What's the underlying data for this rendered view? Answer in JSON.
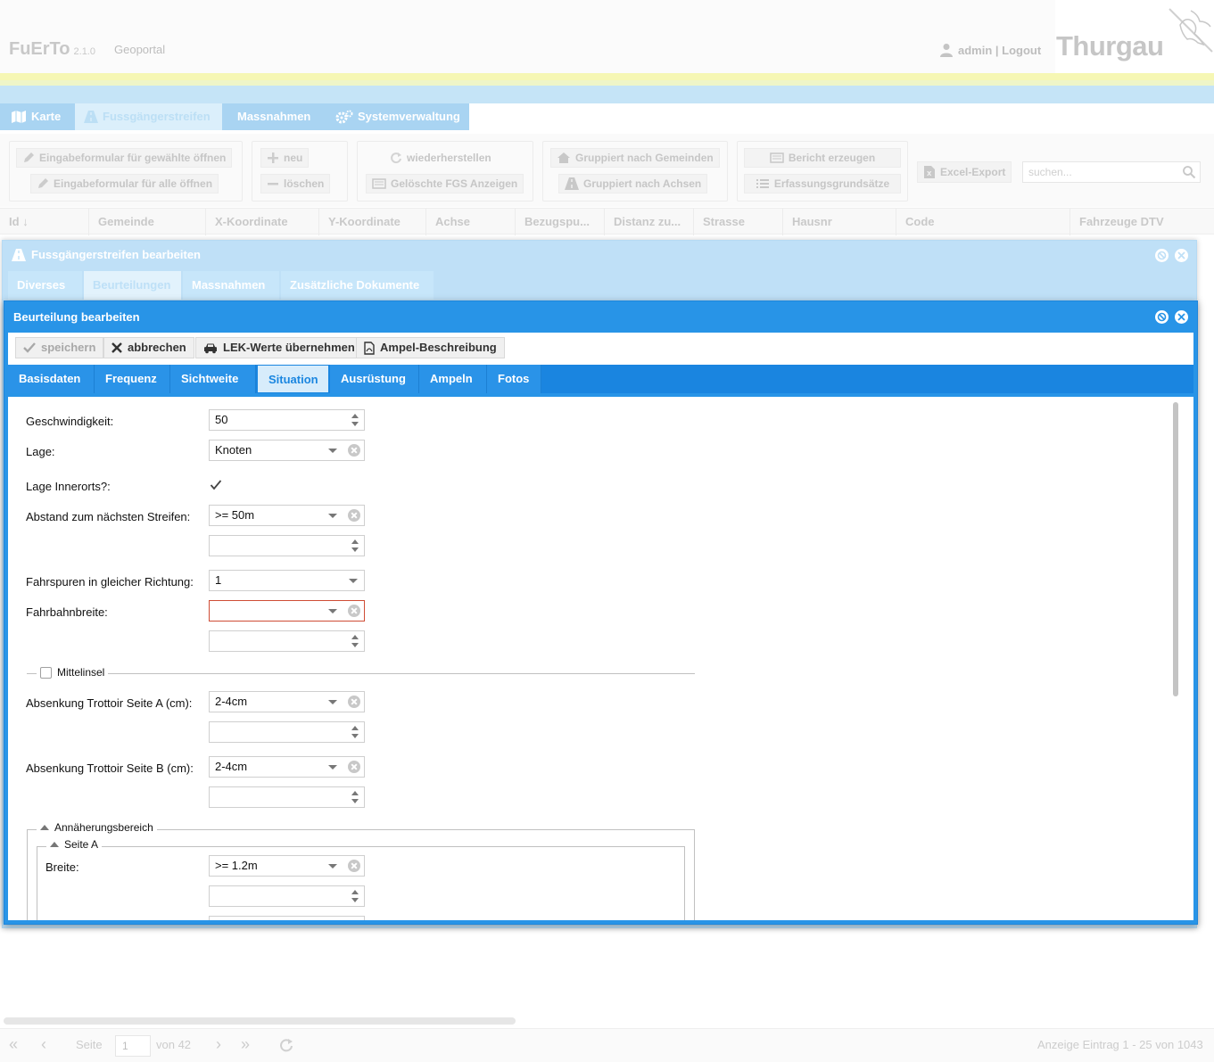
{
  "app": {
    "name": "FuErTo",
    "version": "2.1.0",
    "geoportal_link": "Geoportal",
    "user_link": "admin | Logout",
    "logo_text": "Thurgau"
  },
  "main_tabs": [
    {
      "label": "Karte",
      "icon": "map-icon"
    },
    {
      "label": "Fussgängerstreifen",
      "icon": "road-icon",
      "active": true
    },
    {
      "label": "Massnahmen"
    },
    {
      "label": "Systemverwaltung",
      "icon": "gears-icon"
    }
  ],
  "toolbar": {
    "open_selected": "Eingabeformular für gewählte öffnen",
    "open_all": "Eingabeformular für alle öffnen",
    "new": "neu",
    "delete": "löschen",
    "restore": "wiederherstellen",
    "show_deleted": "Gelöschte FGS Anzeigen",
    "group_municipality": "Gruppiert nach Gemeinden",
    "group_axis": "Gruppiert nach Achsen",
    "create_report": "Bericht erzeugen",
    "principles": "Erfassungsgrundsätze",
    "excel_export": "Excel-Export",
    "search_placeholder": "suchen..."
  },
  "grid_columns": [
    "Id",
    "Gemeinde",
    "X-Koordinate",
    "Y-Koordinate",
    "Achse",
    "Bezugspu...",
    "Distanz zu...",
    "Strasse",
    "Hausnr",
    "Code",
    "Fahrzeuge DTV"
  ],
  "outer_window": {
    "title": "Fussgängerstreifen bearbeiten",
    "tabs": [
      "Diverses",
      "Beurteilungen",
      "Massnahmen",
      "Zusätzliche Dokumente"
    ],
    "active_tab": "Beurteilungen"
  },
  "inner_window": {
    "title": "Beurteilung bearbeiten",
    "buttons": {
      "save": "speichern",
      "cancel": "abbrechen",
      "lek": "LEK-Werte übernehmen",
      "ampel": "Ampel-Beschreibung"
    },
    "tabs": [
      "Basisdaten",
      "Frequenz",
      "Sichtweite",
      "Situation",
      "Ausrüstung",
      "Ampeln",
      "Fotos"
    ],
    "active_tab": "Situation"
  },
  "form": {
    "geschwindigkeit": {
      "label": "Geschwindigkeit:",
      "value": "50"
    },
    "lage": {
      "label": "Lage:",
      "value": "Knoten"
    },
    "lage_innerorts": {
      "label": "Lage Innerorts?:",
      "checked": true
    },
    "abstand": {
      "label": "Abstand zum nächsten Streifen:",
      "value": ">= 50m",
      "extra": ""
    },
    "fahrspuren": {
      "label": "Fahrspuren in gleicher Richtung:",
      "value": "1"
    },
    "fahrbahnbreite": {
      "label": "Fahrbahnbreite:",
      "value": "",
      "extra": ""
    },
    "mittelinsel": {
      "label": "Mittelinsel",
      "checked": false
    },
    "absenkung_a": {
      "label": "Absenkung Trottoir Seite A (cm):",
      "value": "2-4cm",
      "extra": ""
    },
    "absenkung_b": {
      "label": "Absenkung Trottoir Seite B (cm):",
      "value": "2-4cm",
      "extra": ""
    },
    "annaeherung": {
      "label": "Annäherungsbereich"
    },
    "seite_a": {
      "label": "Seite A"
    },
    "breite": {
      "label": "Breite:",
      "value": ">= 1.2m",
      "extra": ""
    }
  },
  "pager": {
    "page_label": "Seite",
    "page_value": "1",
    "of_label": "von 42",
    "summary": "Anzeige Eintrag 1 - 25 von 1043"
  }
}
